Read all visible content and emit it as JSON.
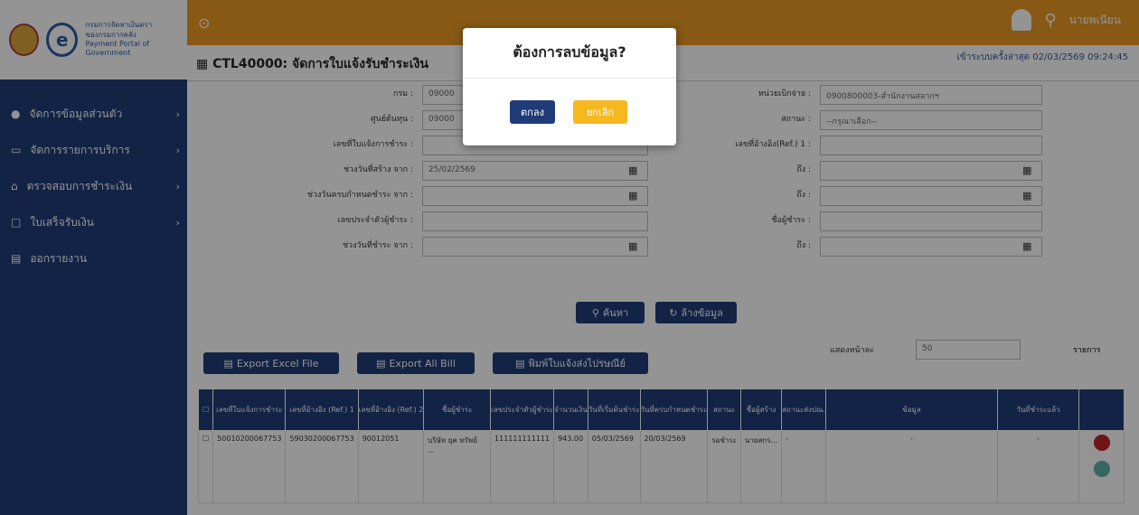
{
  "logo": {
    "line1": "กรมการจัดหาเงินตรา",
    "line2": "ของกรมการคลัง",
    "line3": "Payment Portal of Government"
  },
  "sidebar": {
    "items": [
      {
        "label": "จัดการข้อมูลส่วนตัว",
        "icon": "user-icon"
      },
      {
        "label": "จัดการรายการบริการ",
        "icon": "list-icon"
      },
      {
        "label": "ตรวจสอบการชำระเงิน",
        "icon": "bank-icon"
      },
      {
        "label": "ใบเสร็จรับเงิน",
        "icon": "receipt-icon"
      },
      {
        "label": "ออกรายงาน",
        "icon": "report-icon"
      }
    ]
  },
  "header": {
    "user": "นายพเนียน",
    "last_login": "เข้าระบบครั้งล่าสุด 02/03/2569 09:24:45"
  },
  "page": {
    "title": "CTL40000: จัดการใบแจ้งรับชำระเงิน"
  },
  "form": {
    "left": [
      {
        "label": "กรม :",
        "value": "09000"
      },
      {
        "label": "ศูนย์ต้นทุน :",
        "value": "09000"
      },
      {
        "label": "เลขที่ใบแจ้งการชำระ :",
        "value": ""
      },
      {
        "label": "ช่วงวันที่สร้าง จาก :",
        "value": "25/02/2569"
      },
      {
        "label": "ช่วงวันครบกำหนดชำระ จาก :",
        "value": ""
      },
      {
        "label": "เลขประจำตัวผู้ชำระ :",
        "value": ""
      },
      {
        "label": "ช่วงวันที่ชำระ จาก :",
        "value": ""
      }
    ],
    "right": [
      {
        "label": "หน่วยเบิกจ่าย :",
        "value": "0900800003-สำนักงานสลากฯ"
      },
      {
        "label": "สถานะ :",
        "value": "--กรุณาเลือก--"
      },
      {
        "label": "เลขที่อ้างอิง(Ref.) 1 :",
        "value": ""
      },
      {
        "label": "ถึง :",
        "value": ""
      },
      {
        "label": "ถึง :",
        "value": ""
      },
      {
        "label": "ชื่อผู้ชำระ :",
        "value": ""
      },
      {
        "label": "ถึง :",
        "value": ""
      }
    ]
  },
  "buttons": {
    "search": "ค้นหา",
    "clear": "ล้างข้อมูล",
    "export_excel": "Export Excel File",
    "export_all": "Export All Bill",
    "print": "พิมพ์ใบแจ้งส่งไปรษณีย์"
  },
  "pagination": {
    "label": "แสดงหน้าละ",
    "value": "50",
    "unit": "รายการ"
  },
  "table": {
    "headers": [
      "เลขที่ใบแจ้งการชำระ",
      "เลขที่อ้างอิง (Ref.) 1",
      "เลขที่อ้างอิง (Ref.) 2",
      "ชื่อผู้ชำระ",
      "เลขประจำตัวผู้ชำระ",
      "จำนวนเงิน",
      "วันที่เริ่มต้นชำระ",
      "วันที่ครบกำหนดชำระ",
      "สถานะ",
      "ชื่อผู้สร้าง",
      "สถานะส่งปณ.",
      "ข้อมูล",
      "วันที่ชำระแล้ว"
    ],
    "rows": [
      [
        "50010200067753",
        "59030200067753",
        "90012051",
        "บริษัท ยุค ทรัพย์ ...",
        "111111111111",
        "943.00",
        "05/03/2569",
        "20/03/2569",
        "รอชำระ",
        "นายสกร...",
        "-",
        "-",
        "-"
      ]
    ]
  },
  "dialog": {
    "title": "ต้องการลบข้อมูล?",
    "ok": "ตกลง",
    "cancel": "ยกเลิก"
  }
}
